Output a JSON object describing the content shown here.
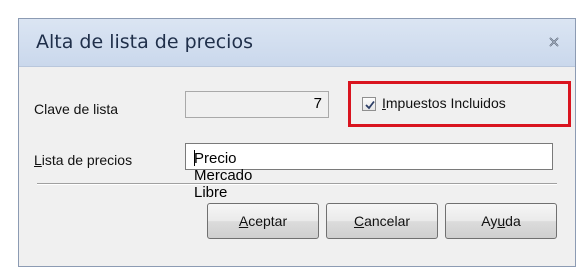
{
  "dialog": {
    "title": "Alta de lista de precios",
    "close_icon": "close-icon"
  },
  "form": {
    "clave_label_acc": "",
    "clave_label_rest": "Clave de lista",
    "clave_value": "7",
    "lista_label_acc": "L",
    "lista_label_rest": "ista de precios",
    "lista_value": "Precio Mercado Libre",
    "impuestos_checked": true,
    "impuestos_label_acc": "I",
    "impuestos_label_rest": "mpuestos Incluidos"
  },
  "buttons": {
    "aceptar_acc": "A",
    "aceptar_rest": "ceptar",
    "cancelar_acc": "C",
    "cancelar_rest": "ancelar",
    "ayuda_pre": "Ay",
    "ayuda_acc": "u",
    "ayuda_rest": "da"
  },
  "colors": {
    "highlight_border": "#d9141f",
    "title_bar": "#cad8ec"
  }
}
